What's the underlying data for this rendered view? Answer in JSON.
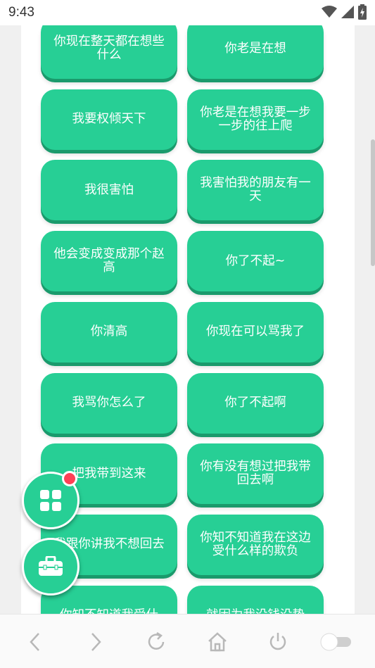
{
  "status": {
    "time": "9:43"
  },
  "grid": [
    [
      "你现在整天都在想些什么",
      "你老是在想"
    ],
    [
      "我要权倾天下",
      "你老是在想我要一步一步的往上爬"
    ],
    [
      "我很害怕",
      "我害怕我的朋友有一天"
    ],
    [
      "他会变成变成那个赵高",
      "你了不起~"
    ],
    [
      "你清高",
      "你现在可以骂我了"
    ],
    [
      "我骂你怎么了",
      "你了不起啊"
    ],
    [
      "把我带到这来",
      "你有没有想过把我带回去啊"
    ],
    [
      "我跟你讲我不想回去",
      "你知不知道我在这边受什么样的欺负"
    ],
    [
      "你知不知道我受什",
      "就因为我没钱没势"
    ]
  ],
  "colors": {
    "button": "#27cf95",
    "button_shadow": "#1a9a6c",
    "badge": "#ff4056"
  },
  "fabs": {
    "top_icon": "grid-icon",
    "bottom_icon": "toolbox-icon"
  },
  "nav": [
    "back-icon",
    "forward-icon",
    "refresh-icon",
    "home-icon",
    "power-icon",
    "toggle"
  ]
}
